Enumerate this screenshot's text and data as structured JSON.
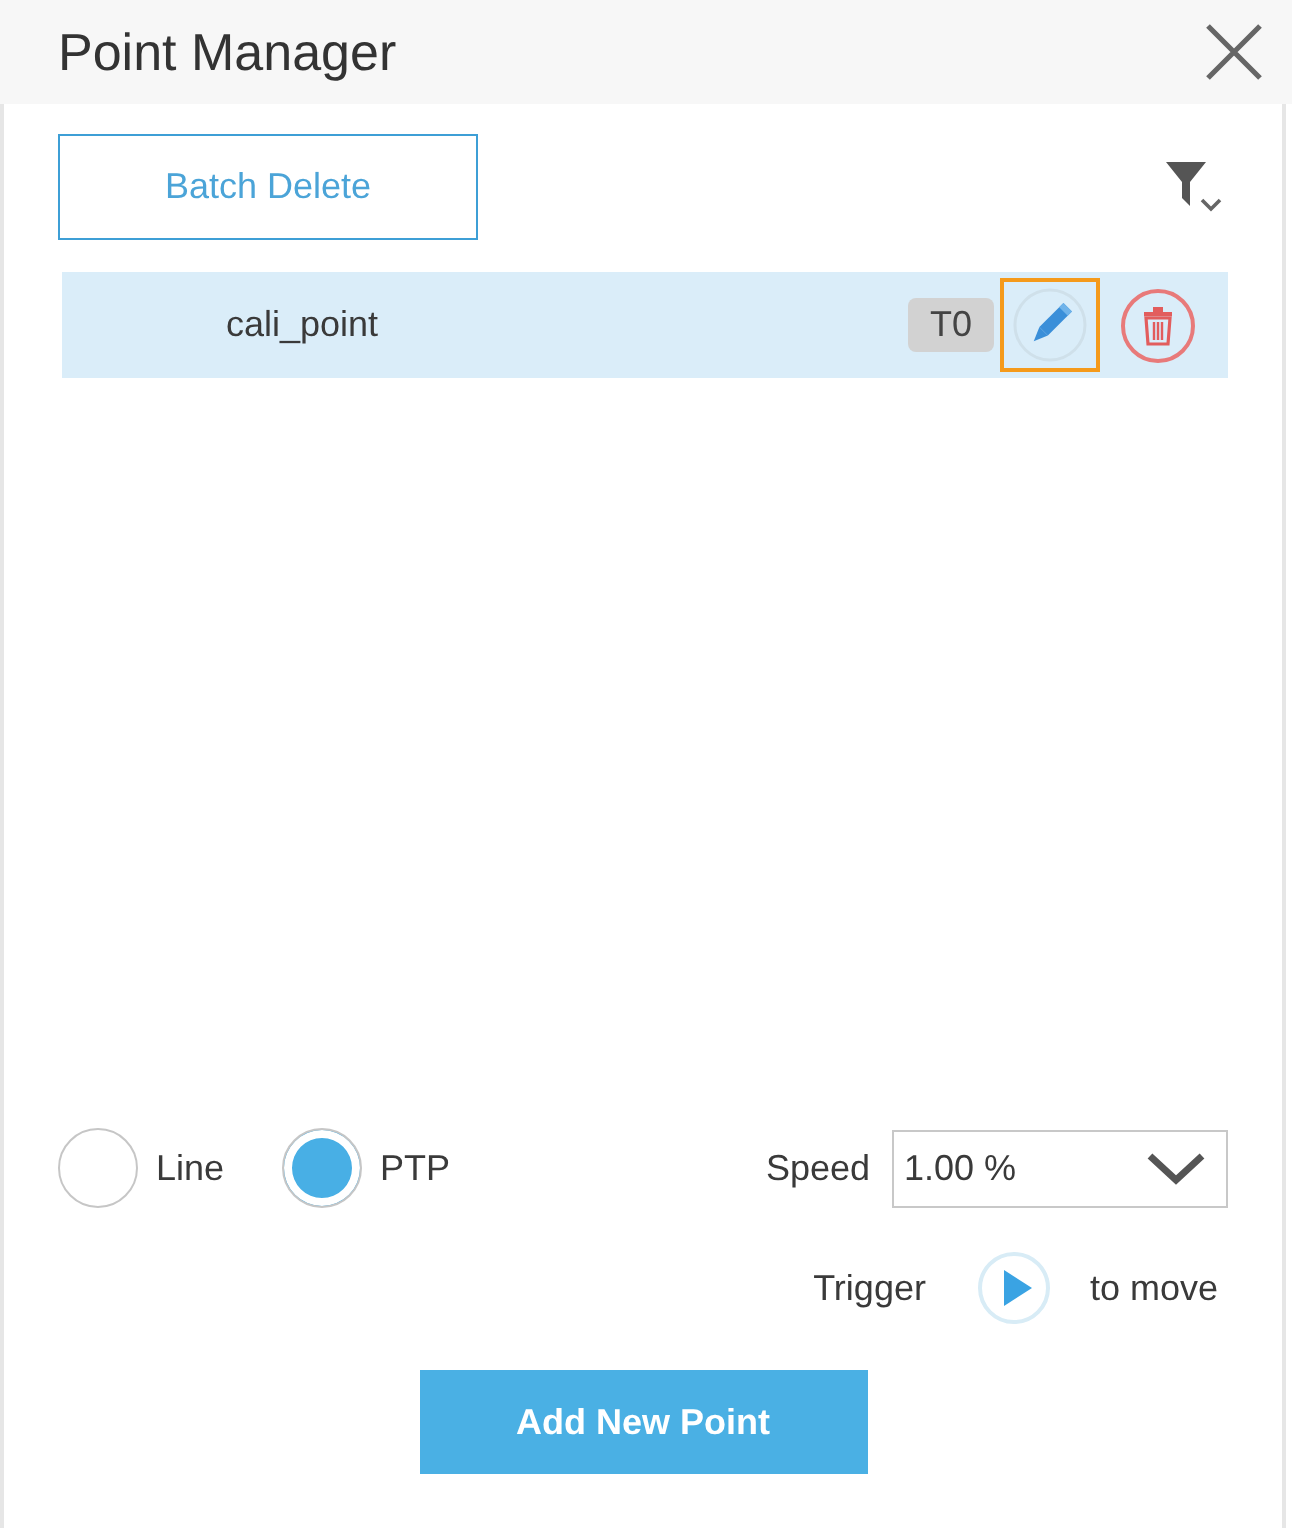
{
  "window": {
    "title": "Point Manager"
  },
  "toolbar": {
    "batch_delete": "Batch Delete"
  },
  "points": [
    {
      "name": "cali_point",
      "tag": "T0",
      "selected": true,
      "actions": [
        {
          "kind": "edit",
          "focused": true
        },
        {
          "kind": "delete",
          "focused": false
        }
      ]
    }
  ],
  "motion_modes": [
    {
      "label": "Line",
      "selected": false
    },
    {
      "label": "PTP",
      "selected": true
    }
  ],
  "speed": {
    "label": "Speed",
    "value": "1.00 %"
  },
  "trigger": {
    "before": "Trigger",
    "after": "to move"
  },
  "add_button": "Add New Point"
}
